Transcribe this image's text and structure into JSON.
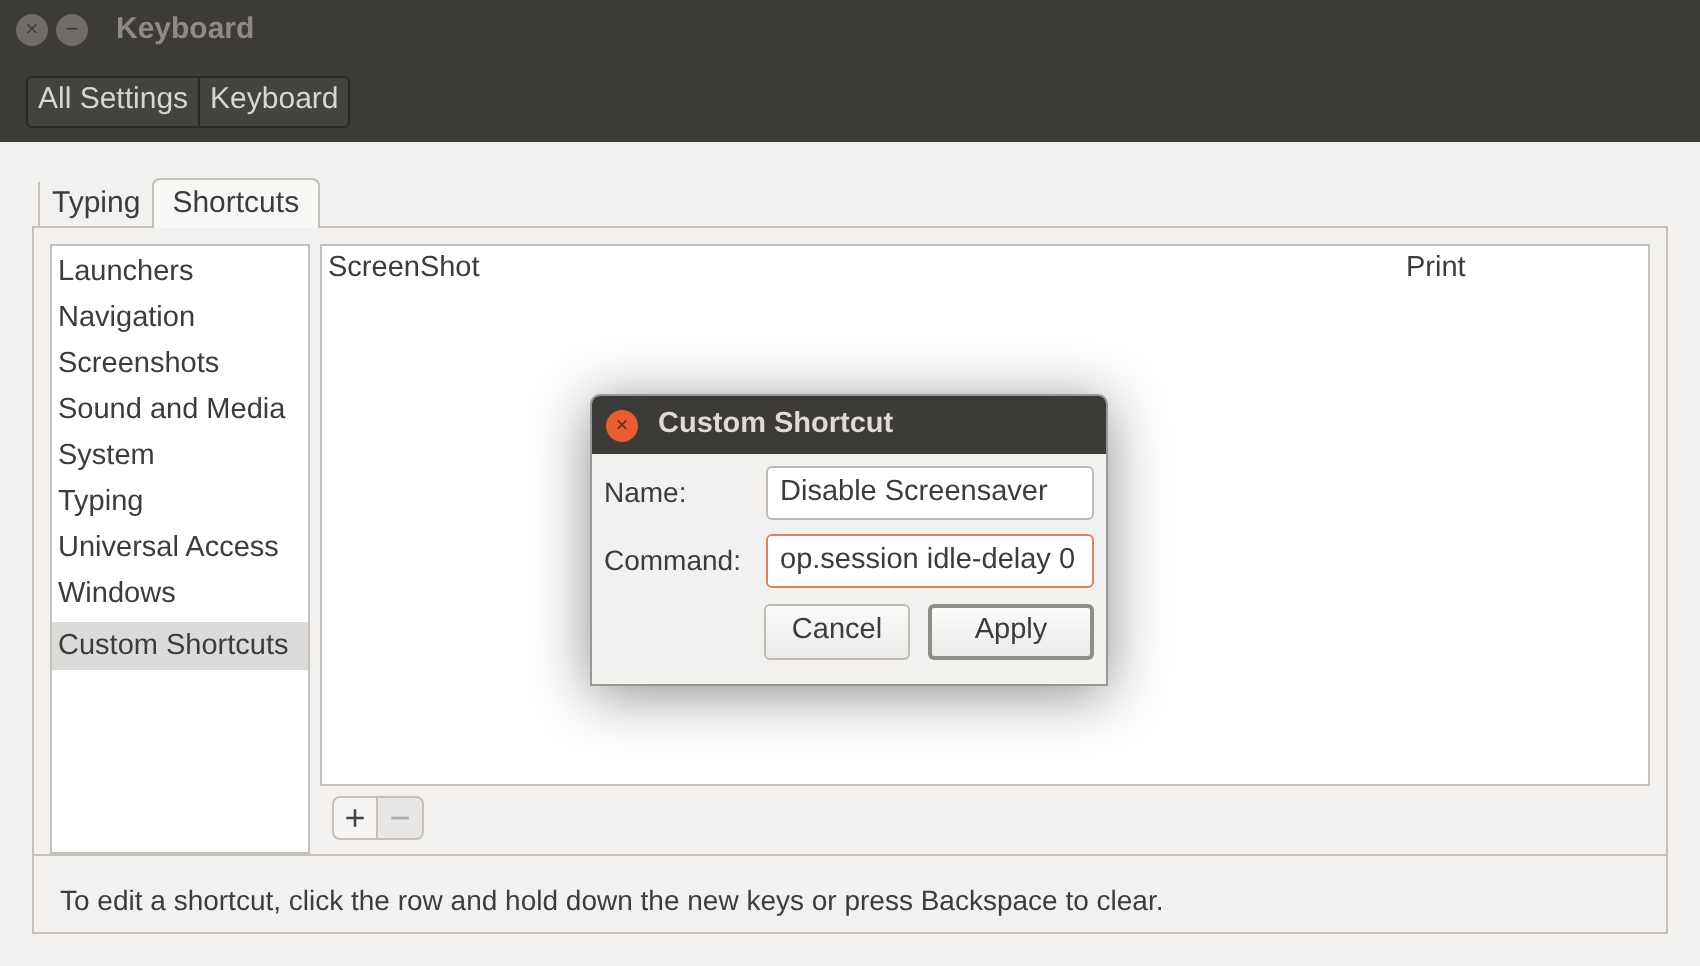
{
  "window": {
    "title": "Keyboard",
    "close": "×",
    "minimize": "−"
  },
  "breadcrumbs": [
    {
      "label": "All Settings"
    },
    {
      "label": "Keyboard"
    }
  ],
  "tabs": [
    {
      "label": "Typing",
      "selected": false
    },
    {
      "label": "Shortcuts",
      "selected": true
    }
  ],
  "categories": [
    {
      "label": "Launchers",
      "selected": false
    },
    {
      "label": "Navigation",
      "selected": false
    },
    {
      "label": "Screenshots",
      "selected": false
    },
    {
      "label": "Sound and Media",
      "selected": false
    },
    {
      "label": "System",
      "selected": false
    },
    {
      "label": "Typing",
      "selected": false
    },
    {
      "label": "Universal Access",
      "selected": false
    },
    {
      "label": "Windows",
      "selected": false
    },
    {
      "label": "Custom Shortcuts",
      "selected": true
    }
  ],
  "shortcuts": [
    {
      "action": "ScreenShot",
      "keys": "Print"
    }
  ],
  "list_buttons": [
    {
      "label": "+",
      "disabled": false
    },
    {
      "label": "−",
      "disabled": true
    }
  ],
  "help_text": "To edit a shortcut, click the row and hold down the new keys or press Backspace to clear.",
  "dialog": {
    "title": "Custom Shortcut",
    "close": "×",
    "fields": [
      {
        "label": "Name:",
        "value": "Disable Screensaver",
        "focused": false
      },
      {
        "label": "Command:",
        "value": "op.session idle-delay 0",
        "focused": true
      }
    ],
    "buttons": [
      {
        "label": "Cancel",
        "default": false
      },
      {
        "label": "Apply",
        "default": true
      }
    ]
  }
}
